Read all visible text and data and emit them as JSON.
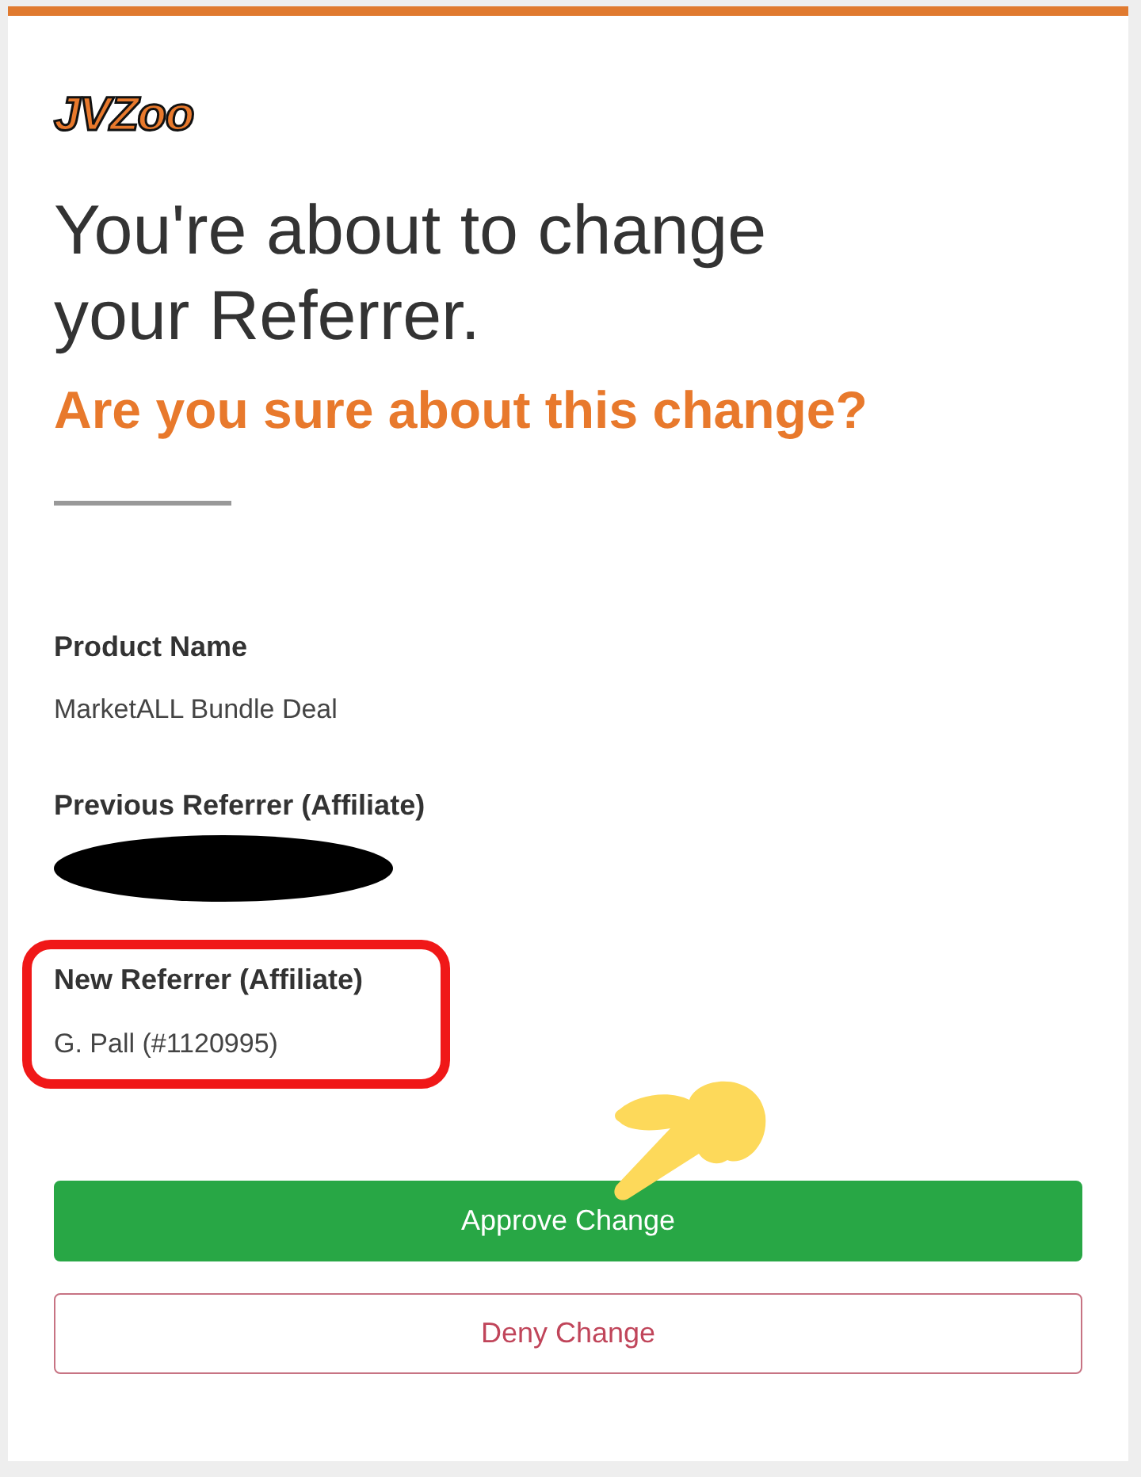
{
  "logo": {
    "text": "JVZoo"
  },
  "title": "You're about to change your Referrer.",
  "subtitle": "Are you sure about this change?",
  "fields": [
    {
      "label": "Product Name",
      "value": "MarketALL Bundle Deal",
      "redacted": false,
      "highlighted": false
    },
    {
      "label": "Previous Referrer (Affiliate)",
      "redacted": true,
      "highlighted": false
    },
    {
      "label": "New Referrer (Affiliate)",
      "value": "G. Pall (#1120995)",
      "redacted": false,
      "highlighted": true
    }
  ],
  "buttons": [
    {
      "label": "Approve Change",
      "kind": "primary"
    },
    {
      "label": "Deny Change",
      "kind": "outline"
    }
  ]
}
